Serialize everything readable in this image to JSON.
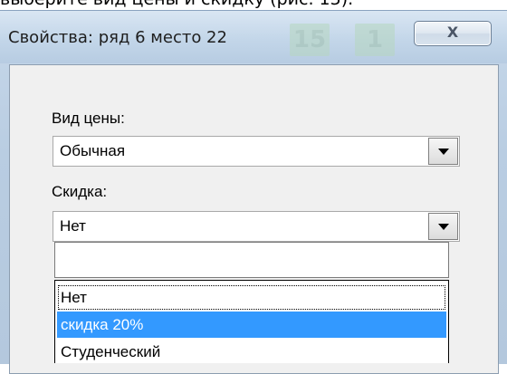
{
  "background_caption": "выберите вид цены и скидку (рис. 15).",
  "background_seats": [
    "15",
    "1"
  ],
  "window": {
    "title": "Свойства: ряд 6 место 22",
    "close_glyph": "X"
  },
  "price_type": {
    "label": "Вид цены:",
    "value": "Обычная"
  },
  "discount": {
    "label": "Скидка:",
    "value": "Нет",
    "edit_value": "",
    "options": [
      "Нет",
      "скидка 20%",
      "Студенческий"
    ],
    "focused_option": "Нет",
    "selected_option": "скидка 20%"
  },
  "colors": {
    "selection": "#3399ff",
    "window_frame": "#b9cde2"
  },
  "icons": {
    "combo_arrow": "triangle-down-icon",
    "close": "close-icon"
  }
}
